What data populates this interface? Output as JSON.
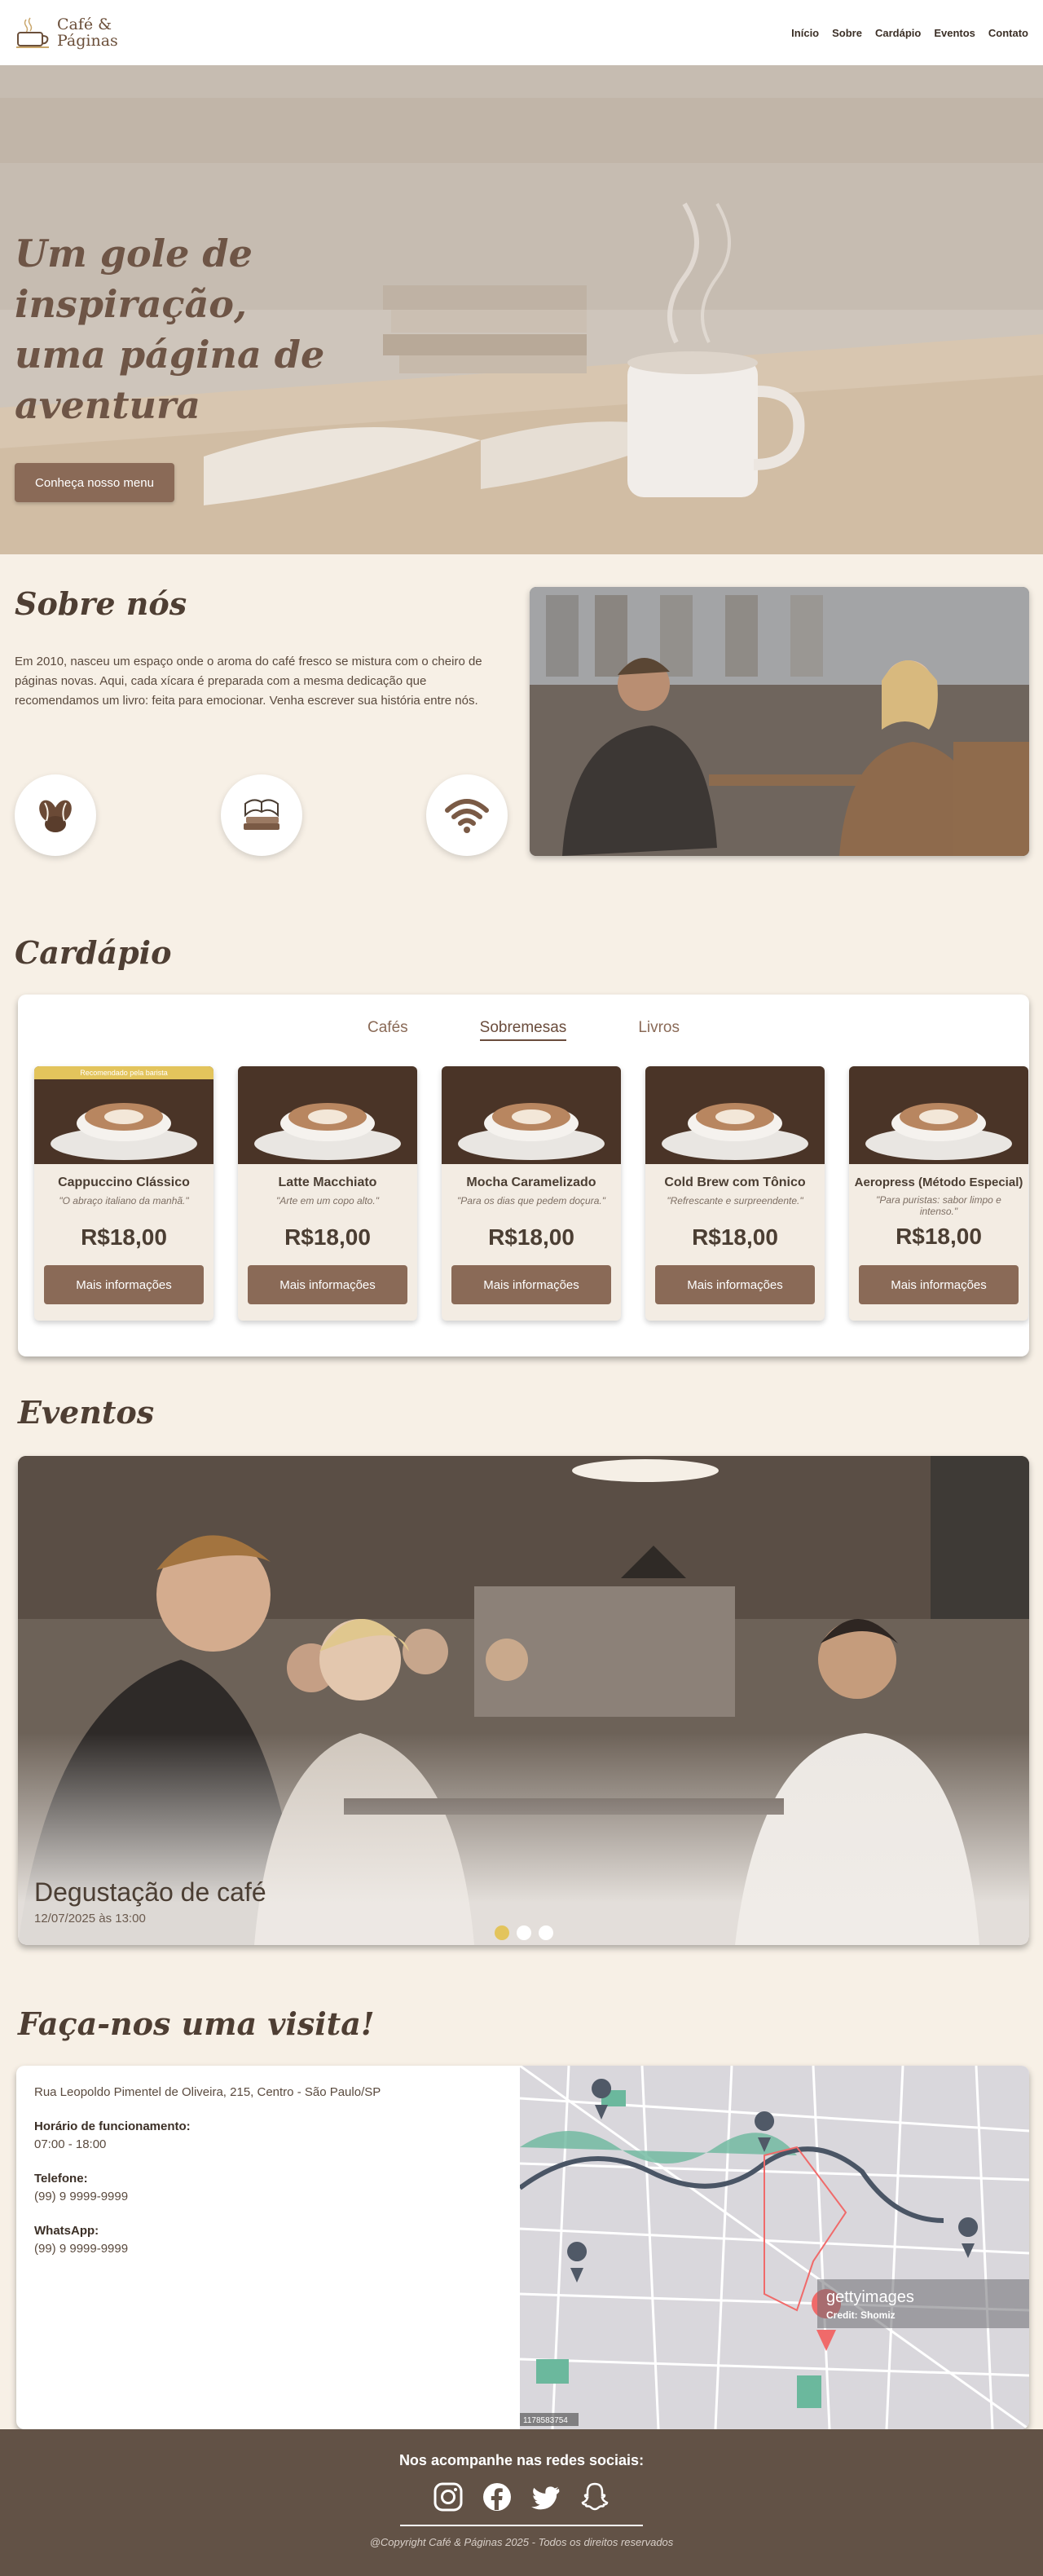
{
  "brand": {
    "name_line1": "Café &",
    "name_line2": "Páginas"
  },
  "nav": {
    "items": [
      "Início",
      "Sobre",
      "Cardápio",
      "Eventos",
      "Contato"
    ]
  },
  "hero": {
    "title_line1": "Um gole de inspiração,",
    "title_line2": "uma página de",
    "title_line3": "aventura",
    "cta": "Conheça nosso menu"
  },
  "about": {
    "title": "Sobre nós",
    "text": "Em 2010, nasceu um espaço onde o aroma do café fresco se mistura com o cheiro de páginas novas. Aqui, cada xícara é preparada com a mesma dedicação que recomendamos um livro: feita para emocionar. Venha escrever sua história entre nós.",
    "icons": [
      "coffee-beans-icon",
      "books-icon",
      "wifi-icon"
    ]
  },
  "menu": {
    "title": "Cardápio",
    "tabs": [
      "Cafés",
      "Sobremesas",
      "Livros"
    ],
    "active_tab": "Sobremesas",
    "products": [
      {
        "name": "Cappuccino Clássico",
        "desc": "\"O abraço italiano da manhã.\"",
        "price": "R$18,00",
        "badge": "Recomendado pela barista",
        "button": "Mais informações"
      },
      {
        "name": "Latte Macchiato",
        "desc": "\"Arte em um copo alto.\"",
        "price": "R$18,00",
        "button": "Mais informações"
      },
      {
        "name": "Mocha Caramelizado",
        "desc": "\"Para os dias que pedem doçura.\"",
        "price": "R$18,00",
        "button": "Mais informações"
      },
      {
        "name": "Cold Brew com Tônico",
        "desc": "\"Refrescante e surpreendente.\"",
        "price": "R$18,00",
        "button": "Mais informações"
      },
      {
        "name": "Aeropress (Método Especial)",
        "desc": "\"Para puristas: sabor limpo e intenso.\"",
        "price": "R$18,00",
        "button": "Mais informações"
      }
    ]
  },
  "events": {
    "title": "Eventos",
    "slide": {
      "title": "Degustação de café",
      "date": "12/07/2025 às 13:00"
    },
    "dots": 3,
    "active_dot": 0
  },
  "visit": {
    "title": "Faça-nos uma visita!",
    "address": "Rua Leopoldo Pimentel de Oliveira, 215, Centro - São Paulo/SP",
    "hours_label": "Horário de funcionamento:",
    "hours": "07:00 - 18:00",
    "phone_label": "Telefone:",
    "phone": "(99) 9 9999-9999",
    "whatsapp_label": "WhatsApp:",
    "whatsapp": "(99) 9 9999-9999",
    "map_watermark": "gettyimages",
    "map_credit": "Credit: Shomiz",
    "map_id": "1178583754"
  },
  "footer": {
    "title": "Nos acompanhe nas redes sociais:",
    "socials": [
      "instagram-icon",
      "facebook-icon",
      "twitter-icon",
      "snapchat-icon"
    ],
    "copyright": "@Copyright Café & Páginas 2025 - Todos os direitos reservados"
  },
  "colors": {
    "primary": "#8a6a57",
    "accent": "#e3c45c",
    "background": "#f7f0e6",
    "footer": "#625246"
  }
}
